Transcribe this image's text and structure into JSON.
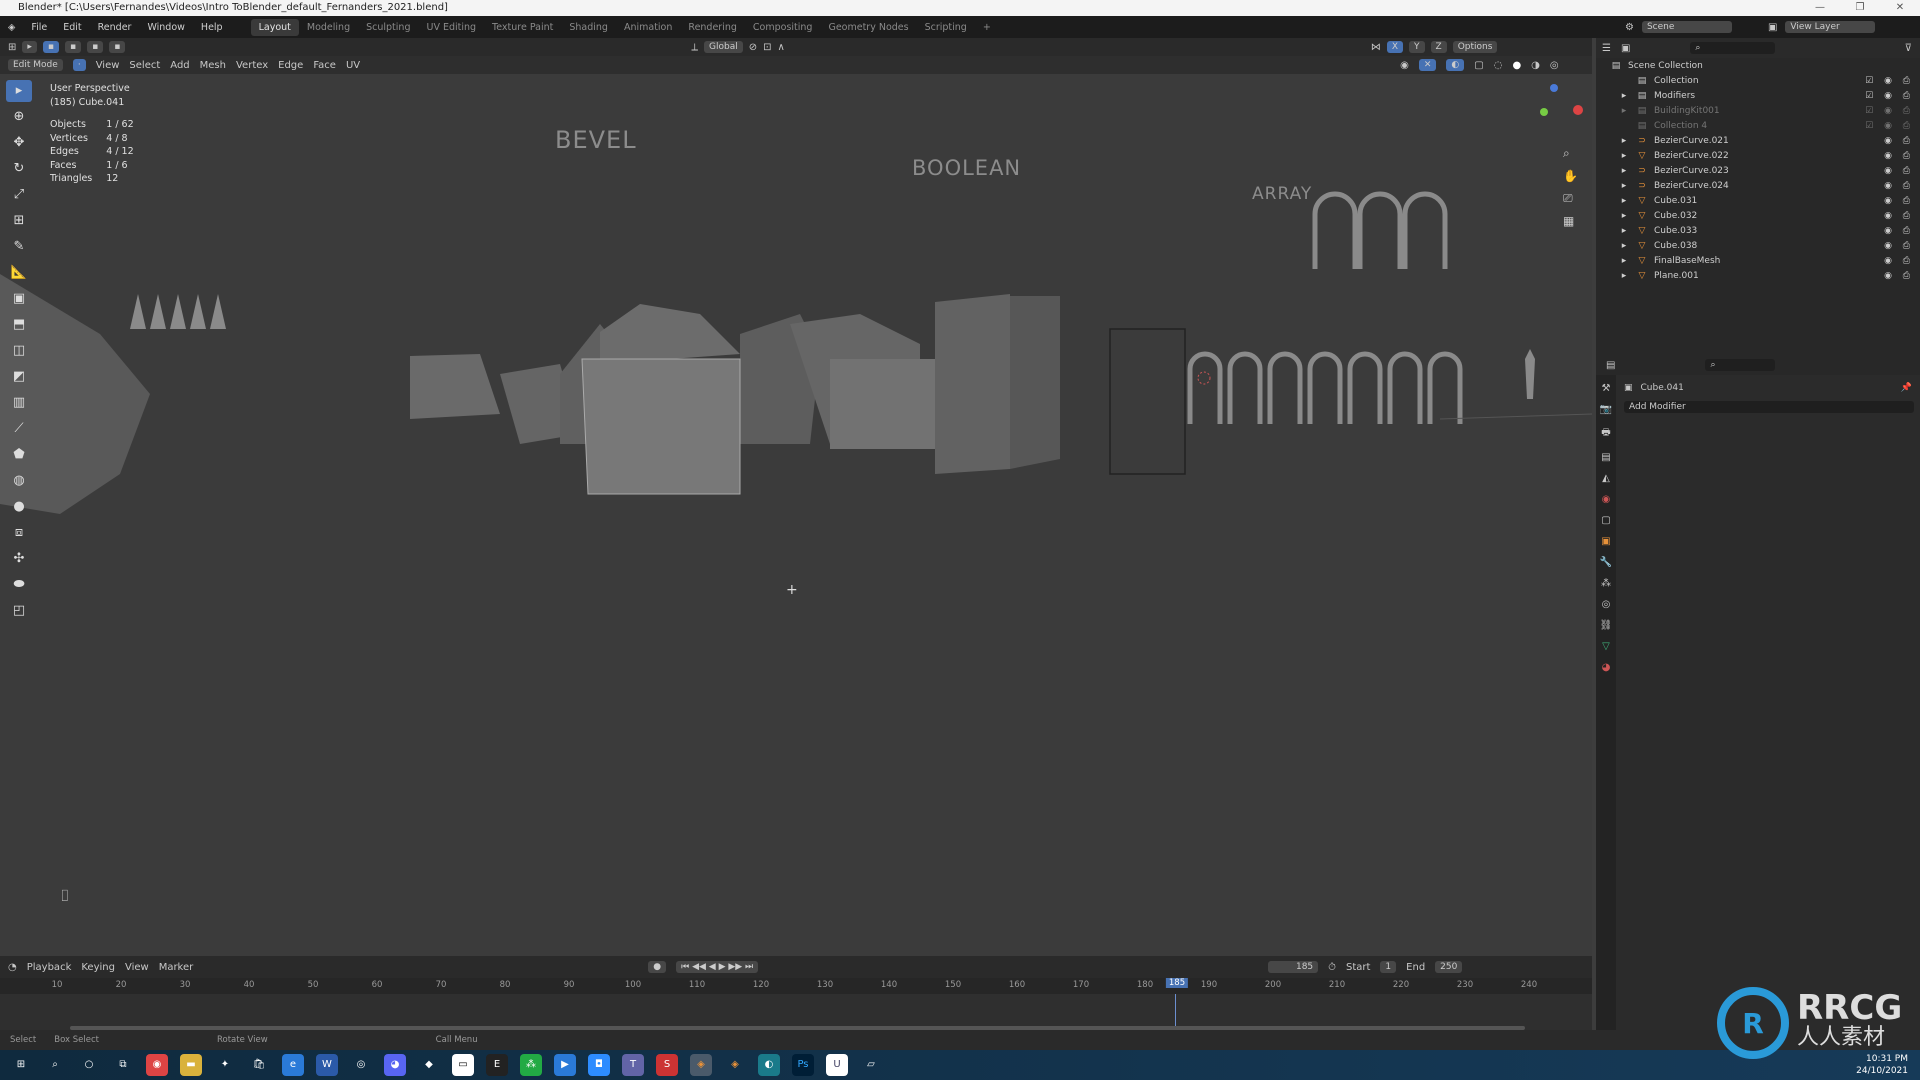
{
  "titlebar": {
    "title": "Blender* [C:\\Users\\Fernandes\\Videos\\Intro ToBlender_default_Fernanders_2021.blend]",
    "controls": [
      "—",
      "❐",
      "✕"
    ]
  },
  "menu": [
    "File",
    "Edit",
    "Render",
    "Window",
    "Help"
  ],
  "workspaces": [
    "Layout",
    "Modeling",
    "Sculpting",
    "UV Editing",
    "Texture Paint",
    "Shading",
    "Animation",
    "Rendering",
    "Compositing",
    "Geometry Nodes",
    "Scripting"
  ],
  "active_workspace": "Layout",
  "scene": {
    "scene_name": "Scene",
    "view_layer": "View Layer"
  },
  "tool_header": {
    "orientation": "Global",
    "options": "Options",
    "axes": [
      "X",
      "Y",
      "Z"
    ]
  },
  "viewport_header": {
    "mode": "Edit Mode",
    "menus": [
      "View",
      "Select",
      "Add",
      "Mesh",
      "Vertex",
      "Edge",
      "Face",
      "UV"
    ]
  },
  "overlay": {
    "view": "User Perspective",
    "object": "(185) Cube.041",
    "stats": [
      {
        "label": "Objects",
        "value": "1 / 62"
      },
      {
        "label": "Vertices",
        "value": "4 / 8"
      },
      {
        "label": "Edges",
        "value": "4 / 12"
      },
      {
        "label": "Faces",
        "value": "1 / 6"
      },
      {
        "label": "Triangles",
        "value": "12"
      }
    ]
  },
  "scene_labels": {
    "bevel": "BEVEL",
    "boolean": "BOOLEAN",
    "array": "ARRAY"
  },
  "outliner": {
    "root": "Scene Collection",
    "items": [
      {
        "name": "Collection",
        "type": "collection"
      },
      {
        "name": "Modifiers",
        "type": "collection"
      },
      {
        "name": "BuildingKit001",
        "type": "collection"
      },
      {
        "name": "Collection 4",
        "type": "collection"
      },
      {
        "name": "BezierCurve.021",
        "type": "curve"
      },
      {
        "name": "BezierCurve.022",
        "type": "mesh"
      },
      {
        "name": "BezierCurve.023",
        "type": "curve"
      },
      {
        "name": "BezierCurve.024",
        "type": "curve"
      },
      {
        "name": "Cube.031",
        "type": "mesh"
      },
      {
        "name": "Cube.032",
        "type": "mesh"
      },
      {
        "name": "Cube.033",
        "type": "mesh"
      },
      {
        "name": "Cube.038",
        "type": "mesh"
      },
      {
        "name": "FinalBaseMesh",
        "type": "mesh"
      },
      {
        "name": "Plane.001",
        "type": "mesh"
      }
    ]
  },
  "properties": {
    "object": "Cube.041",
    "add_modifier": "Add Modifier"
  },
  "timeline": {
    "menus": [
      "Playback",
      "Keying",
      "View",
      "Marker"
    ],
    "current_frame": "185",
    "start_label": "Start",
    "start": "1",
    "end_label": "End",
    "end": "250",
    "ticks": [
      "10",
      "20",
      "30",
      "40",
      "50",
      "60",
      "70",
      "80",
      "90",
      "100",
      "110",
      "120",
      "130",
      "140",
      "150",
      "160",
      "170",
      "180",
      "185",
      "190",
      "200",
      "210",
      "220",
      "230",
      "240"
    ]
  },
  "statusbar": [
    "Select",
    "Box Select",
    "Rotate View",
    "Call Menu"
  ],
  "taskbar": {
    "time": "10:31 PM",
    "date": "24/10/2021"
  },
  "logo": {
    "text": "RRCG",
    "subtext": "人人素材"
  },
  "colors": {
    "accent": "#4772b3",
    "mesh_orange": "#e8923a",
    "data_green": "#3fb07a"
  }
}
